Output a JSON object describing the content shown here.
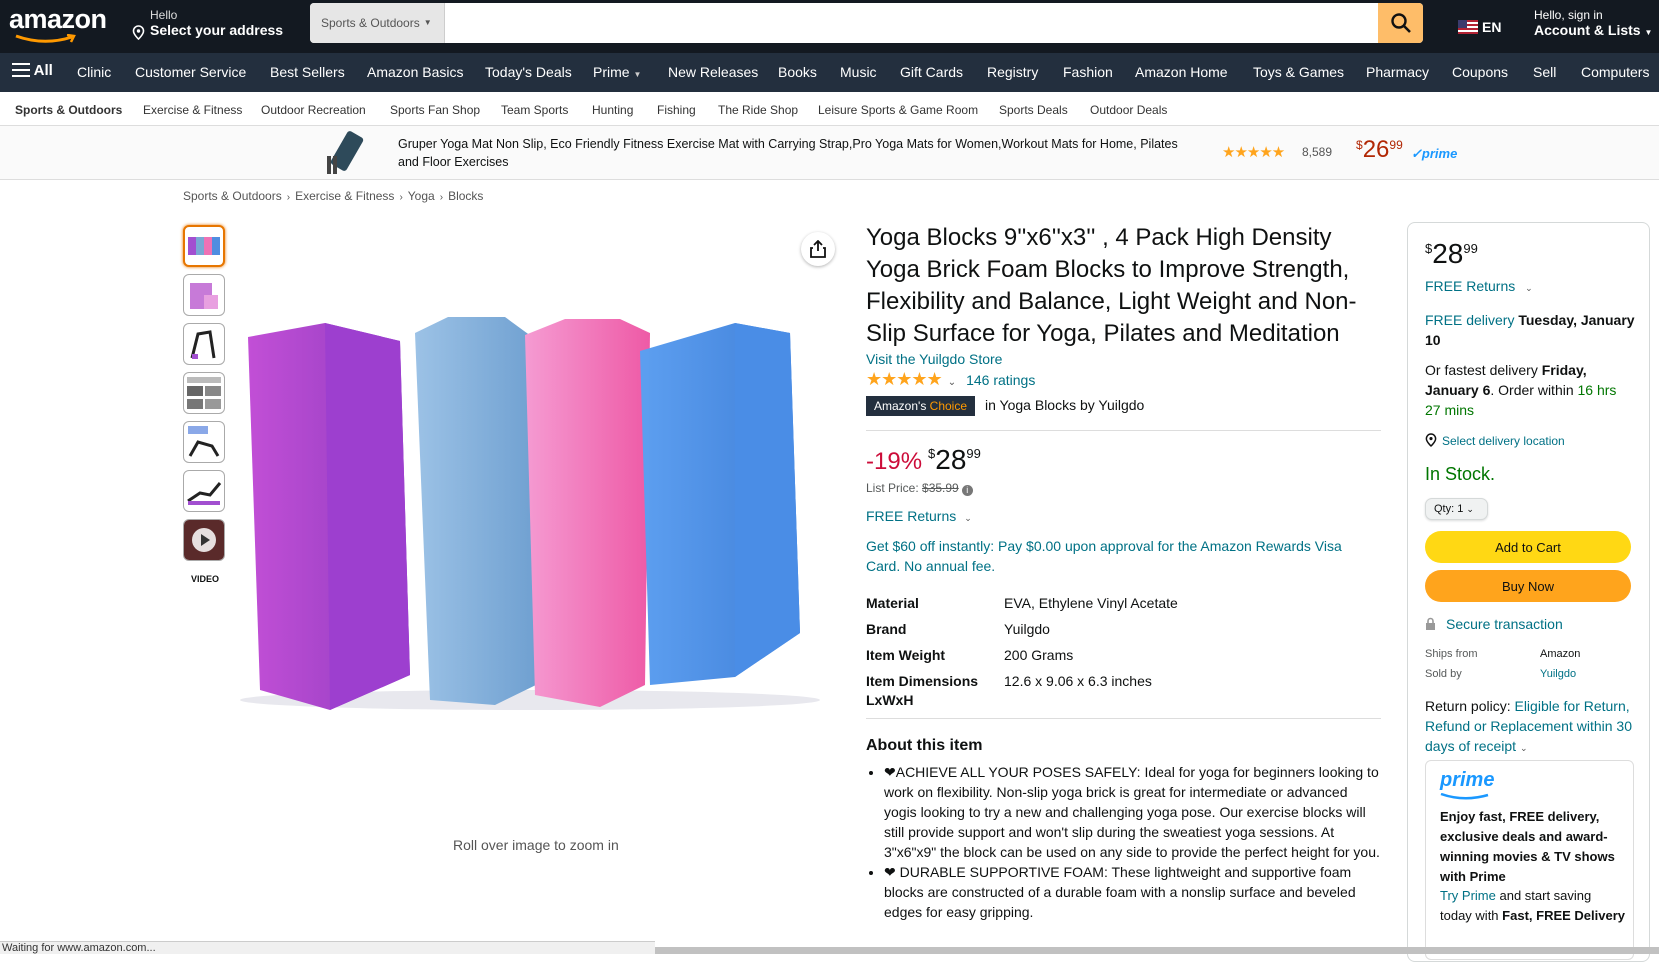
{
  "header": {
    "logo": "amazon",
    "address_hello": "Hello",
    "address_cta": "Select your address",
    "search_category": "Sports & Outdoors",
    "search_placeholder": "",
    "lang": "EN",
    "account_hello": "Hello, sign in",
    "account_lists": "Account & Lists"
  },
  "nav": {
    "all": "All",
    "items": [
      "Clinic",
      "Customer Service",
      "Best Sellers",
      "Amazon Basics",
      "Today's Deals",
      "Prime",
      "New Releases",
      "Books",
      "Music",
      "Gift Cards",
      "Registry",
      "Fashion",
      "Amazon Home",
      "Toys & Games",
      "Pharmacy",
      "Coupons",
      "Sell",
      "Computers"
    ]
  },
  "subnav": {
    "items": [
      "Sports & Outdoors",
      "Exercise & Fitness",
      "Outdoor Recreation",
      "Sports Fan Shop",
      "Team Sports",
      "Hunting",
      "Fishing",
      "The Ride Shop",
      "Leisure Sports & Game Room",
      "Sports Deals",
      "Outdoor Deals"
    ]
  },
  "promo": {
    "title": "Gruper Yoga Mat Non Slip, Eco Friendly Fitness Exercise Mat with Carrying Strap,Pro Yoga Mats for Women,Workout Mats for Home, Pilates and Floor Exercises",
    "stars": "★★★★★",
    "rating_count": "8,589",
    "price_symbol": "$",
    "price_whole": "26",
    "price_fraction": "99",
    "prime": "✓prime"
  },
  "breadcrumb": [
    "Sports & Outdoors",
    "Exercise & Fitness",
    "Yoga",
    "Blocks"
  ],
  "gallery": {
    "video_label": "VIDEO",
    "zoom_hint": "Roll over image to zoom in"
  },
  "product": {
    "title": "Yoga Blocks 9''x6''x3'' , 4 Pack High Density Yoga Brick Foam Blocks to Improve Strength, Flexibility and Balance, Light Weight and Non-Slip Surface for Yoga, Pilates and Meditation",
    "store_link": "Visit the Yuilgdo Store",
    "stars": "★★★★★",
    "ratings": "146 ratings",
    "badge_amazon": "Amazon's",
    "badge_choice": "Choice",
    "badge_context": "in Yoga Blocks by Yuilgdo",
    "discount": "-19%",
    "price_symbol": "$",
    "price_whole": "28",
    "price_fraction": "99",
    "list_price_label": "List Price:",
    "list_price": "$35.99",
    "free_returns": "FREE Returns",
    "offer": "Get $60 off instantly: Pay $0.00 upon approval for the Amazon Rewards Visa Card. No annual fee.",
    "specs": [
      {
        "k": "Material",
        "v": "EVA, Ethylene Vinyl Acetate"
      },
      {
        "k": "Brand",
        "v": "Yuilgdo"
      },
      {
        "k": "Item Weight",
        "v": "200 Grams"
      },
      {
        "k": "Item Dimensions LxWxH",
        "v": "12.6 x 9.06 x 6.3 inches"
      }
    ],
    "about_heading": "About this item",
    "bullets": [
      "❤ACHIEVE ALL YOUR POSES SAFELY: Ideal for yoga for beginners looking to work on flexibility. Non-slip yoga brick is great for intermediate or advanced yogis looking to try a new and challenging yoga pose. Our exercise blocks will still provide support and won't slip during the sweatiest yoga sessions. At 3\"x6\"x9\" the block can be used on any side to provide the perfect height for you.",
      "❤ DURABLE SUPPORTIVE FOAM: These lightweight and supportive foam blocks are constructed of a durable foam with a nonslip surface and beveled edges for easy gripping."
    ]
  },
  "buybox": {
    "price_symbol": "$",
    "price_whole": "28",
    "price_fraction": "99",
    "free_returns": "FREE Returns",
    "free_delivery": "FREE delivery",
    "delivery_date": "Tuesday, January 10",
    "fastest_prefix": "Or fastest delivery",
    "fastest_date": "Friday, January 6",
    "order_within": ". Order within",
    "countdown": "16 hrs 27 mins",
    "delivery_location": "Select delivery location",
    "stock": "In Stock.",
    "qty_label": "Qty: 1",
    "add_to_cart": "Add to Cart",
    "buy_now": "Buy Now",
    "secure": "Secure transaction",
    "ships_from_label": "Ships from",
    "ships_from": "Amazon",
    "sold_by_label": "Sold by",
    "sold_by": "Yuilgdo",
    "return_label": "Return policy:",
    "return_policy": "Eligible for Return, Refund or Replacement within 30 days of receipt",
    "prime_logo": "prime",
    "prime_text": "Enjoy fast, FREE delivery, exclusive deals and award-winning movies & TV shows with Prime",
    "try_prime": "Try Prime",
    "prime_tail": "and start saving today with",
    "prime_tail_bold": "Fast, FREE Delivery"
  },
  "status": "Waiting for www.amazon.com...",
  "colors": {
    "header": "#131921",
    "nav": "#232f3e",
    "search_button": "#febd69",
    "add_to_cart": "#ffd814",
    "buy_now": "#ffa41c",
    "link": "#007185",
    "in_stock": "#007600"
  }
}
